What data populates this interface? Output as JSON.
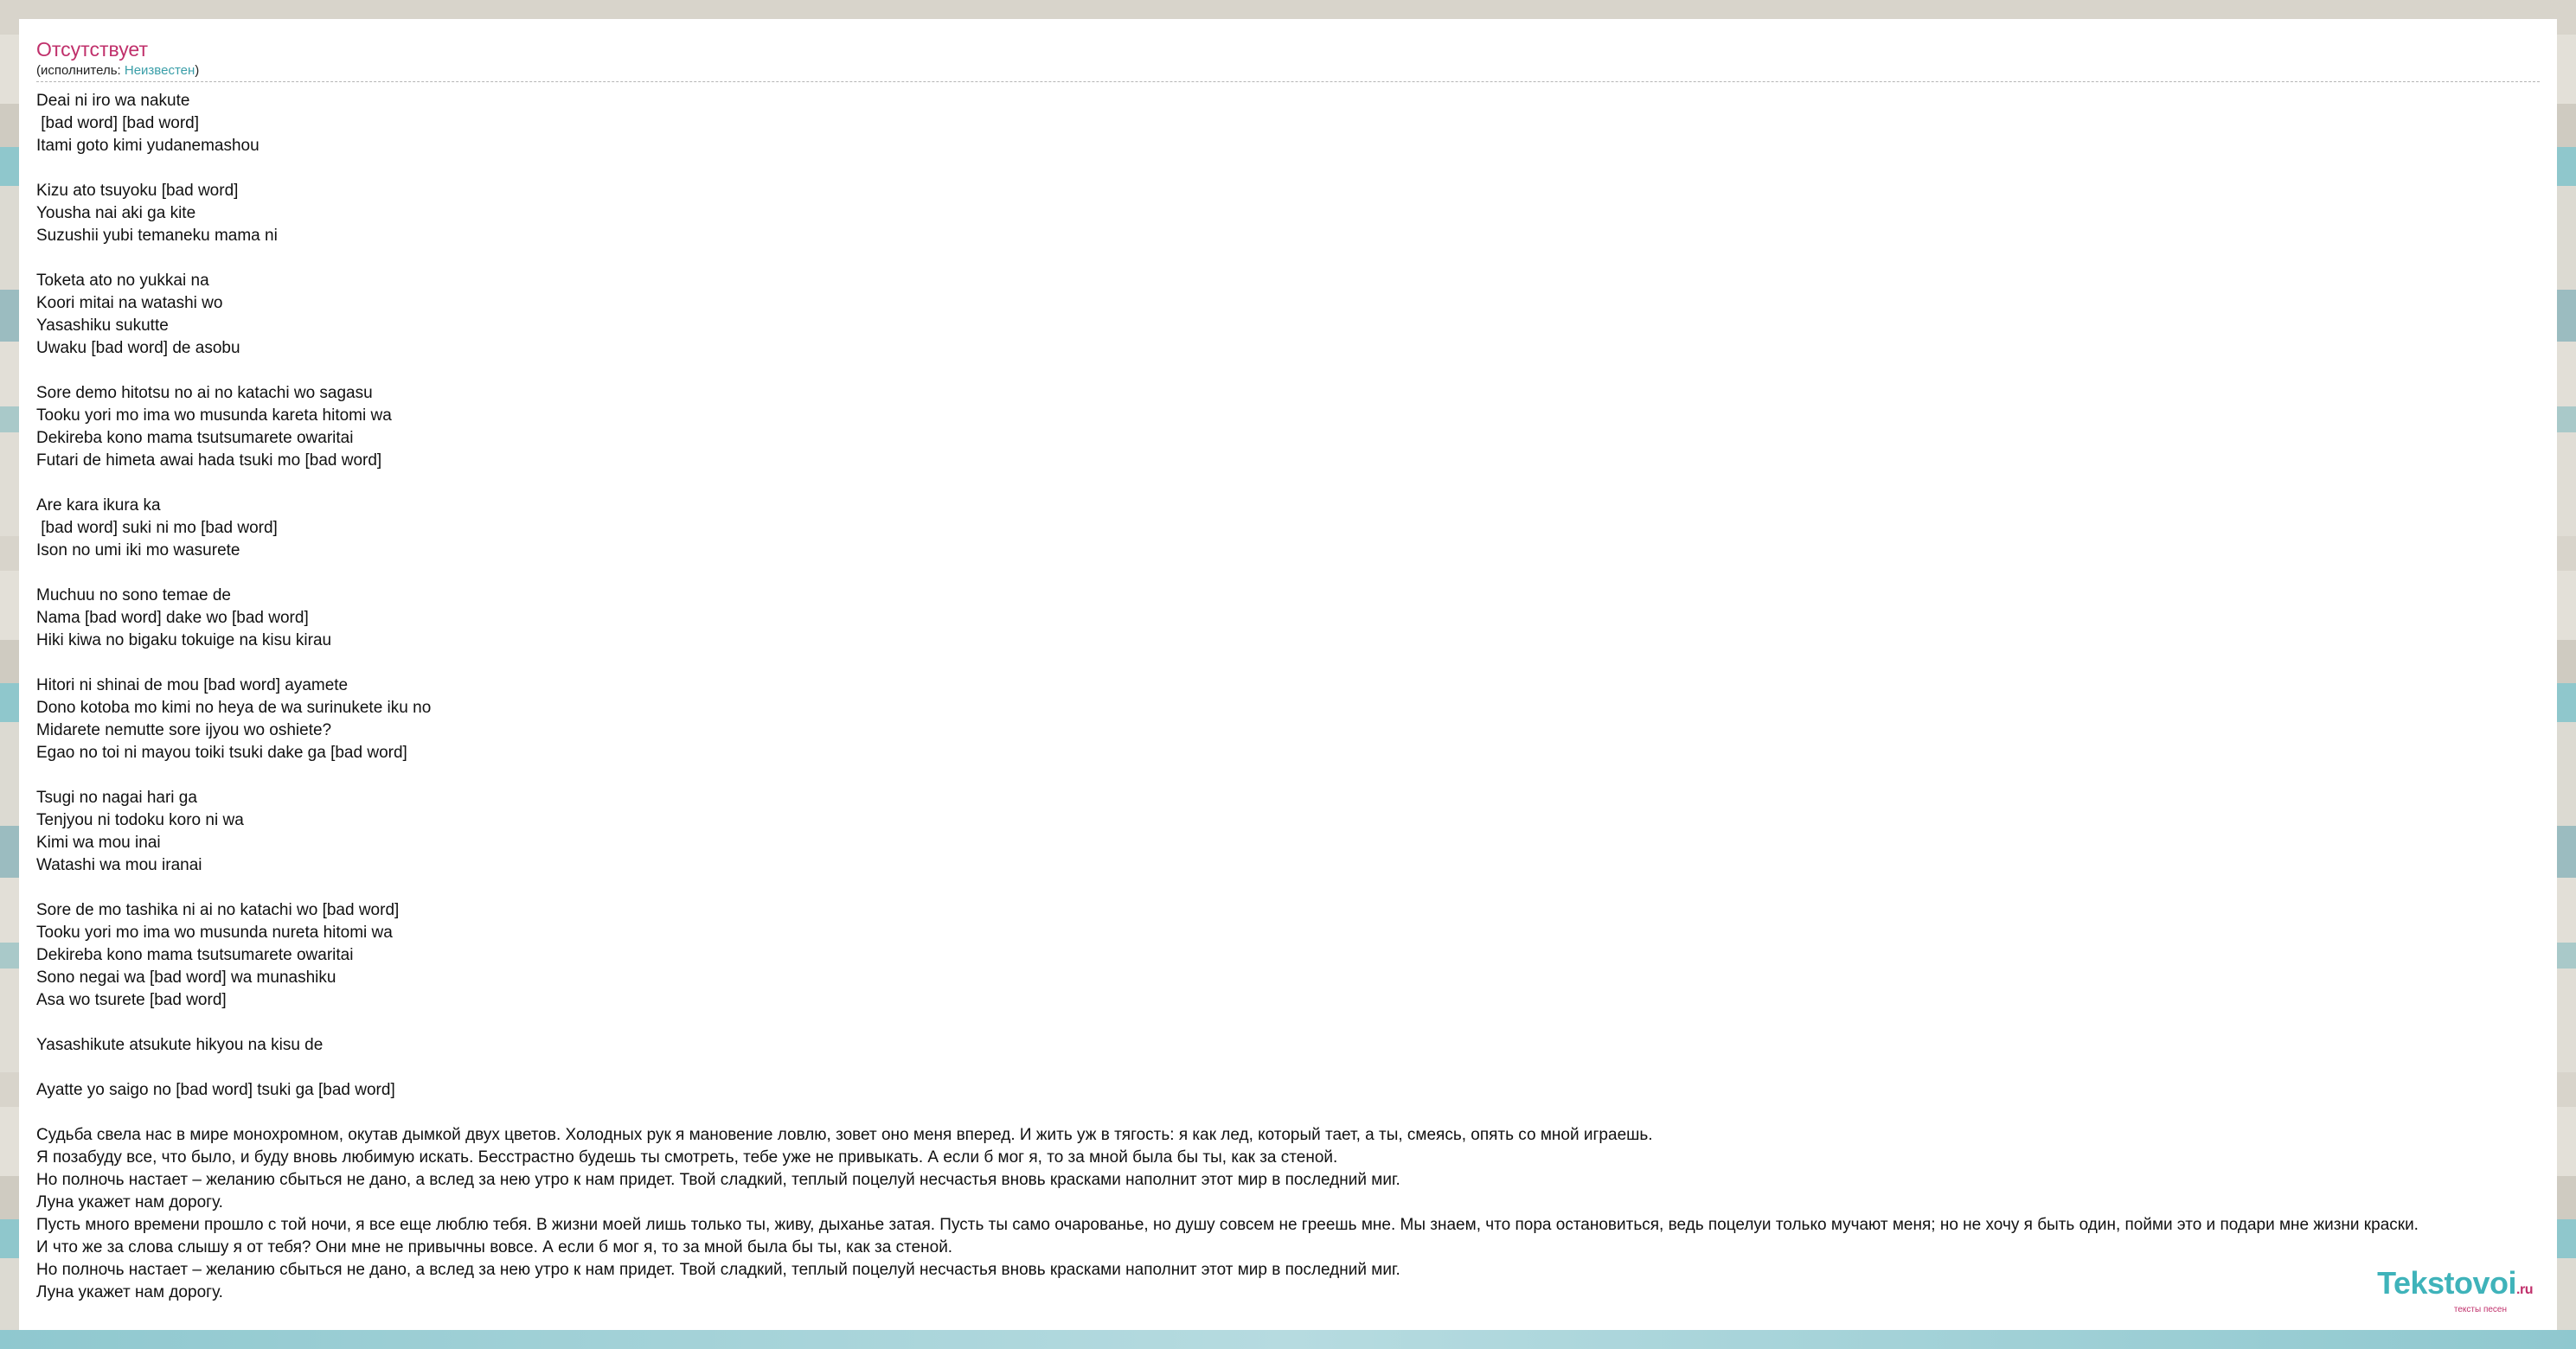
{
  "song": {
    "title": "Отсутствует",
    "performer_prefix": "(исполнитель: ",
    "performer_name": "Неизвестен",
    "performer_suffix": ")"
  },
  "lyrics": {
    "stanzas": [
      [
        "Deai ni iro wa nakute",
        " [bad word] [bad word]",
        "Itami goto kimi yudanemashou"
      ],
      [
        "Kizu ato tsuyoku [bad word]",
        "Yousha nai aki ga kite",
        "Suzushii yubi temaneku mama ni"
      ],
      [
        "Toketa ato no yukkai na",
        "Koori mitai na watashi wo",
        "Yasashiku sukutte",
        "Uwaku [bad word] de asobu"
      ],
      [
        "Sore demo hitotsu no ai no katachi wo sagasu",
        "Tooku yori mo ima wo musunda kareta hitomi wa",
        "Dekireba kono mama tsutsumarete owaritai",
        "Futari de himeta awai hada tsuki mo [bad word]"
      ],
      [
        "Are kara ikura ka",
        " [bad word] suki ni mo [bad word]",
        "Ison no umi iki mo wasurete"
      ],
      [
        "Muchuu no sono temae de",
        "Nama [bad word] dake wo [bad word]",
        "Hiki kiwa no bigaku tokuige na kisu kirau"
      ],
      [
        "Hitori ni shinai de mou [bad word] ayamete",
        "Dono kotoba mo kimi no heya de wa surinukete iku no",
        "Midarete nemutte sore ijyou wo oshiete?",
        "Egao no toi ni mayou toiki tsuki dake ga [bad word]"
      ],
      [
        "Tsugi no nagai hari ga",
        "Tenjyou ni todoku koro ni wa",
        "Kimi wa mou inai",
        "Watashi wa mou iranai"
      ],
      [
        "Sore de mo tashika ni ai no katachi wo [bad word]",
        "Tooku yori mo ima wo musunda nureta hitomi wa",
        "Dekireba kono mama tsutsumarete owaritai",
        "Sono negai wa [bad word] wa munashiku",
        "Asa wo tsurete [bad word]"
      ],
      [
        "Yasashikute atsukute hikyou na kisu de"
      ],
      [
        "Ayatte yo saigo no [bad word] tsuki ga [bad word]"
      ],
      [
        "Судьба свела нас в мире монохромном, окутав дымкой двух цветов. Холодных рук я мановение ловлю, зовет оно меня вперед. И жить уж в тягость: я как лед, который тает, а ты, смеясь, опять со мной играешь.",
        "Я позабуду все, что было, и буду вновь любимую искать. Бесстрастно будешь ты смотреть, тебе уже не привыкать. А если б мог я, то за мной была бы ты, как за стеной.",
        "Но полночь настает – желанию сбыться не дано, а вслед за нею утро к нам придет. Твой сладкий, теплый поцелуй несчастья вновь красками наполнит этот мир в последний миг.",
        "Луна укажет нам дорогу.",
        "Пусть много времени прошло с той ночи, я все еще люблю тебя. В жизни моей лишь только ты, живу, дыханье затая. Пусть ты само очарованье, но душу совсем не греешь мне. Мы знаем, что пора остановиться, ведь поцелуи только мучают меня; но не хочу я быть один, пойми это и подари мне жизни краски.",
        "И что же за слова слышу я от тебя? Они мне не привычны вовсе. А если б мог я, то за мной была бы ты, как за стеной.",
        "Но полночь настает – желанию сбыться не дано, а вслед за нею утро к нам придет. Твой сладкий, теплый поцелуй несчастья вновь красками наполнит этот мир в последний миг.",
        "Луна укажет нам дорогу."
      ]
    ]
  },
  "logo": {
    "name": "Tekstovoi",
    "tld": ".ru",
    "tagline": "тексты песен"
  },
  "colors": {
    "title": "#c0306b",
    "link": "#3a9ea8",
    "logo": "#3fb3ba"
  }
}
